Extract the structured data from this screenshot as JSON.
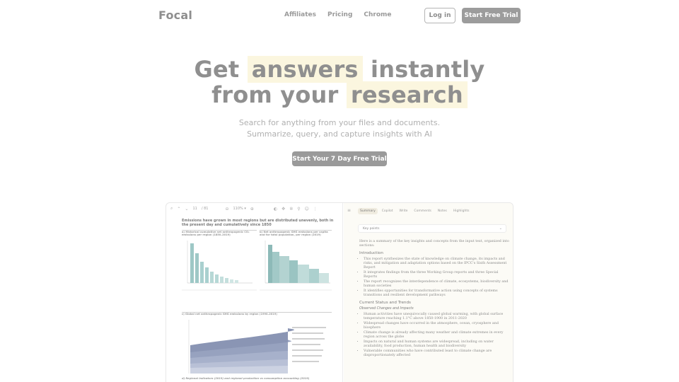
{
  "nav": {
    "logo": "Focal",
    "links": [
      "Affiliates",
      "Pricing",
      "Chrome"
    ],
    "login": "Log in",
    "trial": "Start Free Trial"
  },
  "hero": {
    "line1_a": "Get",
    "line1_hl": "answers",
    "line1_b": "instantly",
    "line2_a": "from your",
    "line2_hl": "research",
    "sub1": "Search for anything from your files and documents.",
    "sub2": "Summarize, query, and capture insights with AI",
    "cta": "Start Your 7 Day Free Trial"
  },
  "pdf": {
    "page": "11",
    "total": "/ 81",
    "zoom": "110% ▾",
    "title": "Emissions have grown in most regions but are distributed unevenly, both in the present day and cumulatively since 1850",
    "cap_a": "a) Historical cumulative net anthropogenic CO₂ emissions per region (1850–2019)",
    "cap_b": "b) Net anthropogenic GHG emissions per capita and for total population, per region (2019)",
    "cap_c": "c) Global net anthropogenic GHG emissions by region (1990–2019)",
    "cap_d": "d) Regional indicators (2019) and regional production vs consumption accounting (2019)"
  },
  "panel": {
    "tabs": [
      "Summary",
      "Copilot",
      "Write",
      "Comments",
      "Notes",
      "Highlights"
    ],
    "select": "Key points",
    "intro": "Here is a summary of the key insights and concepts from the input text, organized into sections:",
    "h_intro": "Introduction",
    "intro_items": [
      "This report synthesizes the state of knowledge on climate change, its impacts and risks, and mitigation and adaptation options based on the IPCC's Sixth Assessment Report",
      "It integrates findings from the three Working Group reports and three Special Reports",
      "The report recognizes the interdependence of climate, ecosystems, biodiversity and human societies",
      "It identifies opportunities for transformative action using concepts of systems transitions and resilient development pathways"
    ],
    "h_status": "Current Status and Trends",
    "h_observed": "Observed Changes and Impacts",
    "observed_items": [
      "Human activities have unequivocally caused global warming, with global surface temperature reaching 1.1°C above 1850-1900 in 2011-2020",
      "Widespread changes have occurred in the atmosphere, ocean, cryosphere and biosphere",
      "Climate change is already affecting many weather and climate extremes in every region across the globe",
      "Impacts on natural and human systems are widespread, including on water availability, food production, human health and biodiversity",
      "Vulnerable communities who have contributed least to climate change are disproportionately affected"
    ]
  }
}
